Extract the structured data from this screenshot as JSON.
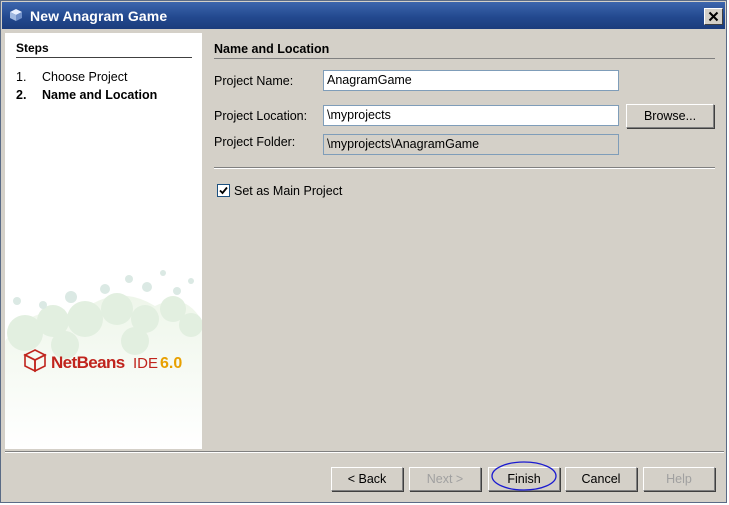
{
  "window": {
    "title": "New Anagram Game",
    "icon": "netbeans-cube-icon"
  },
  "steps": {
    "heading": "Steps",
    "items": [
      {
        "num": "1.",
        "label": "Choose Project",
        "current": false
      },
      {
        "num": "2.",
        "label": "Name and Location",
        "current": true
      }
    ],
    "branding": "NetBeans IDE 6.0"
  },
  "panel": {
    "heading": "Name and Location",
    "project_name": {
      "label": "Project Name:",
      "value": "AnagramGame"
    },
    "project_location": {
      "label": "Project Location:",
      "value": "\\myprojects"
    },
    "project_folder": {
      "label": "Project Folder:",
      "value": "\\myprojects\\AnagramGame"
    },
    "browse_label": "Browse...",
    "main_project": {
      "label": "Set as Main Project",
      "checked": true
    }
  },
  "buttons": {
    "back": "< Back",
    "next": "Next >",
    "finish": "Finish",
    "cancel": "Cancel",
    "help": "Help"
  },
  "colors": {
    "titlebar": "#23498f",
    "dialog_bg": "#d4d0c8",
    "highlight_ring": "#1a1ad0"
  }
}
